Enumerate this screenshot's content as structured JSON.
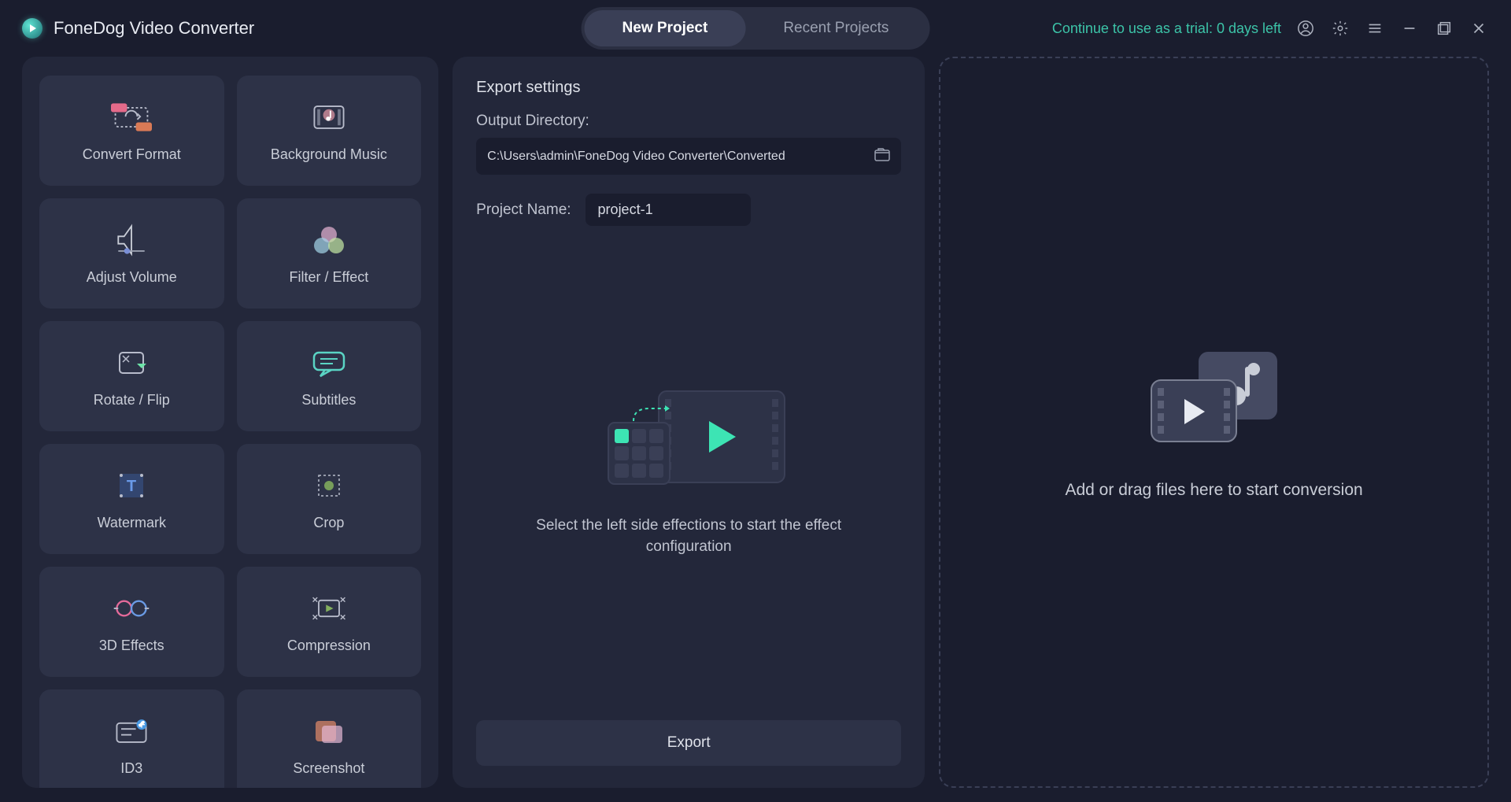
{
  "header": {
    "title": "FoneDog Video Converter",
    "tabs": [
      {
        "label": "New Project",
        "active": true
      },
      {
        "label": "Recent Projects",
        "active": false
      }
    ],
    "trial_text": "Continue to use as a trial: 0 days left"
  },
  "tools": [
    {
      "id": "convert-format",
      "label": "Convert Format"
    },
    {
      "id": "background-music",
      "label": "Background Music"
    },
    {
      "id": "adjust-volume",
      "label": "Adjust Volume"
    },
    {
      "id": "filter-effect",
      "label": "Filter / Effect"
    },
    {
      "id": "rotate-flip",
      "label": "Rotate / Flip"
    },
    {
      "id": "subtitles",
      "label": "Subtitles"
    },
    {
      "id": "watermark",
      "label": "Watermark"
    },
    {
      "id": "crop",
      "label": "Crop"
    },
    {
      "id": "3d-effects",
      "label": "3D Effects"
    },
    {
      "id": "compression",
      "label": "Compression"
    },
    {
      "id": "id3",
      "label": "ID3"
    },
    {
      "id": "screenshot",
      "label": "Screenshot"
    }
  ],
  "export": {
    "section_title": "Export settings",
    "output_label": "Output Directory:",
    "output_path": "C:\\Users\\admin\\FoneDog Video Converter\\Converted",
    "project_label": "Project Name:",
    "project_name": "project-1",
    "hint": "Select the left side effections to start the effect configuration",
    "button_label": "Export"
  },
  "dropzone": {
    "text": "Add or drag files here to start conversion"
  }
}
